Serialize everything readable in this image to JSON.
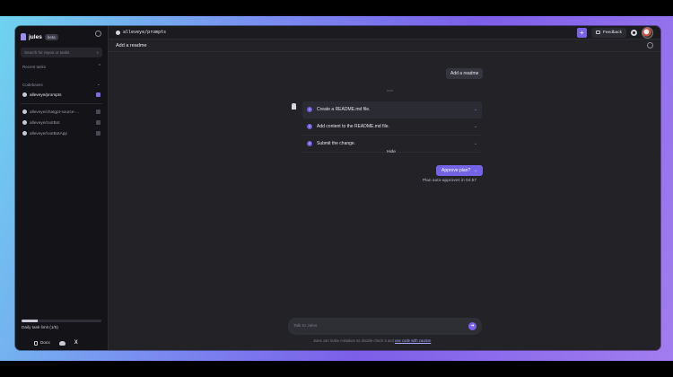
{
  "sidebar": {
    "brand": "jules",
    "badge": "beta",
    "search_placeholder": "Search for repos or tasks",
    "recent_tasks_label": "Recent tasks",
    "codebases_label": "Codebases",
    "repos": [
      {
        "name": "alleveye/prompts",
        "active": true
      },
      {
        "name": "alleveye/chatgpt-source-...",
        "active": false
      },
      {
        "name": "alleveye/rootBot",
        "active": false
      },
      {
        "name": "alleveye/rootBotApp",
        "active": false
      }
    ],
    "daily_limit": "Daily task limit (1/5)",
    "daily_limit_progress": 0.2,
    "docs_label": "Docs"
  },
  "header": {
    "repo_path": "alleveye/prompts",
    "feedback_label": "Feedback"
  },
  "task": {
    "title": "Add a readme",
    "user_message": "Add a readme",
    "timestamp": "now"
  },
  "plan": {
    "steps": [
      {
        "num": "1",
        "text": "Create a README.md file."
      },
      {
        "num": "2",
        "text": "Add content to the README.md file."
      },
      {
        "num": "3",
        "text": "Submit the change."
      }
    ],
    "hide_label": "Hide",
    "approve_label": "Approve plan?",
    "auto_approve": "Plan auto-approves in 04:57"
  },
  "composer": {
    "placeholder": "Talk to Jules",
    "disclaimer_prefix": "Jules can make mistakes so double-check it and ",
    "disclaimer_link": "use code with caution"
  },
  "colors": {
    "accent": "#7563e6"
  }
}
